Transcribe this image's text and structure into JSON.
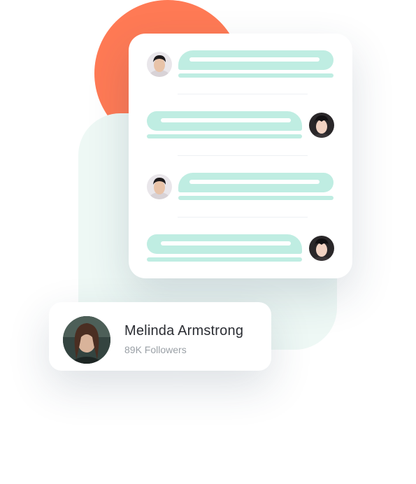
{
  "colors": {
    "accent_orange": "#FF7A55",
    "mint_bubble": "#BFEDE2",
    "mint_panel": "#EEF8F5"
  },
  "chat": {
    "messages": [
      {
        "side": "incoming",
        "avatar": "male-avatar-icon"
      },
      {
        "side": "outgoing",
        "avatar": "female-avatar-icon"
      },
      {
        "side": "incoming",
        "avatar": "male-avatar-icon"
      },
      {
        "side": "outgoing",
        "avatar": "female-avatar-icon"
      }
    ]
  },
  "profile": {
    "name": "Melinda Armstrong",
    "followers": "89K Followers"
  }
}
